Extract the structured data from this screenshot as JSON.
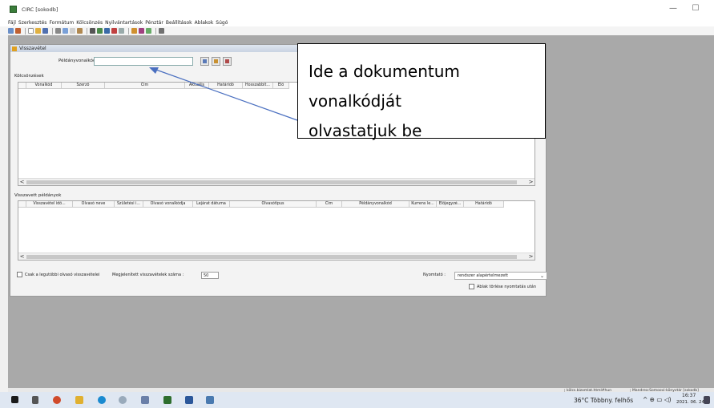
{
  "window": {
    "title": "CIRC [sokodb]",
    "minimize_glyph": "—",
    "maximize_glyph": "☐"
  },
  "menu": [
    "Fájl",
    "Szerkesztés",
    "Formátum",
    "Kölcsönzés",
    "Nyilvántartások",
    "Pénztár",
    "Beállítások",
    "Ablakok",
    "Súgó"
  ],
  "inner_window": {
    "title": "Visszavétel",
    "barcode_label": "Példányvonalkód :",
    "barcode_value": "",
    "loans_title": "Kölcsönzések",
    "loans_columns": [
      "Vonalkód",
      "Szerző",
      "Cím",
      "Aktuális",
      "Határidő",
      "Hosszabbít...",
      "Elő"
    ],
    "returned_title": "Visszavett példányok",
    "returned_columns": [
      "Visszavétel idő...",
      "Olvasó neve",
      "Születési i...",
      "Olvasó vonalkódja",
      "Lejárat dátuma",
      "Olvasótípus",
      "Cím",
      "Példányvonalkód",
      "Kurrens le...",
      "Előjegyzé...",
      "Határidő"
    ],
    "last_reader_label": "Csak a legutóbbi olvasó visszavételei",
    "count_label": "Megjelenített visszavételek száma :",
    "count_value": "50",
    "printer_label": "Nyomtató :",
    "printer_value": "rendszer alapértelmezett",
    "clear_after_print_label": "Ablak törlése nyomtatás után",
    "scroll_left": "<",
    "scroll_right": ">"
  },
  "callout": {
    "line1": "Ide a dokumentum vonalkódját",
    "line2": "olvastatjuk be"
  },
  "statusbar": {
    "cell1": "kölcs.bizomlat.html#hun",
    "cell2": "Mandrea:Somoovi-könyvtár [sokodb]"
  },
  "taskbar": {
    "weather": "36°C Többny. felhős",
    "time": "16:37",
    "date": "2021. 06. 24."
  },
  "colors": {
    "accent": "#3a7d3a",
    "callout_arrow": "#4a6fc0",
    "desktop": "#a9a9a9"
  }
}
